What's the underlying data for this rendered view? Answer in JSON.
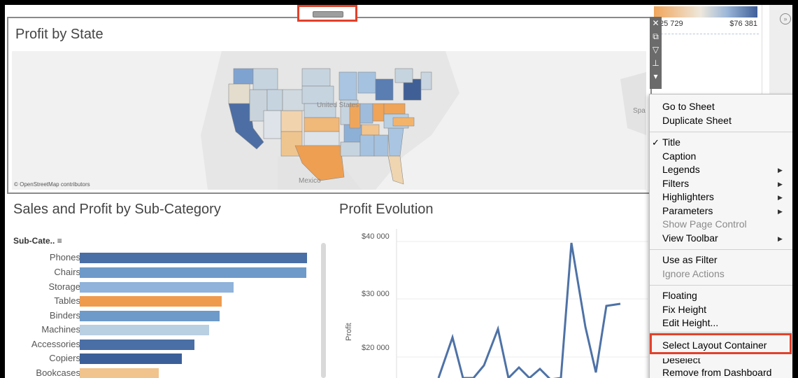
{
  "map_panel": {
    "title": "Profit by State",
    "credit": "© OpenStreetMap contributors",
    "labels": {
      "country": "United States",
      "mexico": "Mexico",
      "spain": "Spa"
    }
  },
  "legend": {
    "min": "25 729",
    "max": "$76 381"
  },
  "sales_panel": {
    "title": "Sales and Profit by Sub-Category",
    "header": "Sub-Cate..",
    "rows": [
      {
        "label": "Phones",
        "color": "#4a6ea6"
      },
      {
        "label": "Chairs",
        "color": "#6d9ac9"
      },
      {
        "label": "Storage",
        "color": "#8fb3da"
      },
      {
        "label": "Tables",
        "color": "#ef9b4e"
      },
      {
        "label": "Binders",
        "color": "#6d9ac9"
      },
      {
        "label": "Machines",
        "color": "#b9cfe2"
      },
      {
        "label": "Accessories",
        "color": "#4a6ea6"
      },
      {
        "label": "Copiers",
        "color": "#3b5f98"
      },
      {
        "label": "Bookcases",
        "color": "#f0c48c"
      }
    ]
  },
  "evolution_panel": {
    "title": "Profit Evolution",
    "ylabel": "Profit",
    "ticks": [
      "$40 000",
      "$30 000",
      "$20 000"
    ]
  },
  "context_menu": {
    "go_to_sheet": "Go to Sheet",
    "duplicate_sheet": "Duplicate Sheet",
    "title": "Title",
    "caption": "Caption",
    "legends": "Legends",
    "filters": "Filters",
    "highlighters": "Highlighters",
    "parameters": "Parameters",
    "show_page_control": "Show Page Control",
    "view_toolbar": "View Toolbar",
    "use_as_filter": "Use as Filter",
    "ignore_actions": "Ignore Actions",
    "floating": "Floating",
    "fix_height": "Fix Height",
    "edit_height": "Edit Height...",
    "select_layout_container": "Select Layout Container",
    "deselect": "Deselect",
    "remove_from_dashboard": "Remove from Dashboard"
  }
}
